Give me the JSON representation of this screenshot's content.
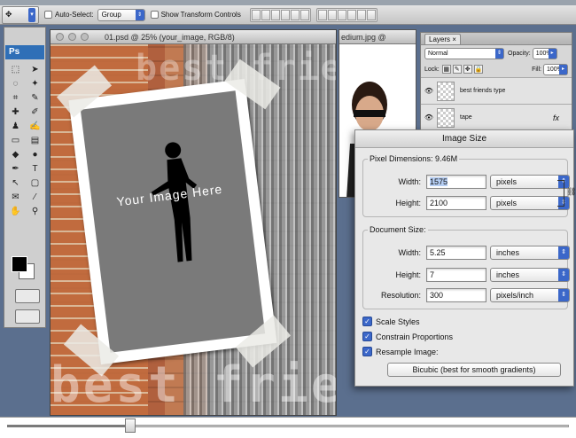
{
  "options_bar": {
    "auto_select_label": "Auto-Select:",
    "auto_select_value": "Group",
    "show_transform_label": "Show Transform Controls"
  },
  "tools_panel": {
    "brand": "Ps"
  },
  "document": {
    "title": "01.psd @ 25% (your_image, RGB/8)",
    "headline_top": "best friends",
    "headline_bottom": "best friends",
    "placeholder_text": "Your Image Here"
  },
  "document2": {
    "title": "edium.jpg @"
  },
  "layers_panel": {
    "tab": "Layers",
    "blend_mode": "Normal",
    "opacity_label": "Opacity:",
    "opacity_value": "100%",
    "lock_label": "Lock:",
    "fill_label": "Fill:",
    "fill_value": "100%",
    "layers": [
      {
        "name": "best friends type"
      },
      {
        "name": "tape",
        "fx": "fx"
      }
    ]
  },
  "image_size_dialog": {
    "title": "Image Size",
    "pixel_dimensions_label": "Pixel Dimensions:",
    "pixel_dimensions_value": "9.46M",
    "width_label": "Width:",
    "width_value": "1575",
    "width_unit": "pixels",
    "height_label": "Height:",
    "height_value": "2100",
    "height_unit": "pixels",
    "document_size_label": "Document Size:",
    "doc_width_label": "Width:",
    "doc_width_value": "5.25",
    "doc_width_unit": "inches",
    "doc_height_label": "Height:",
    "doc_height_value": "7",
    "doc_height_unit": "inches",
    "resolution_label": "Resolution:",
    "resolution_value": "300",
    "resolution_unit": "pixels/inch",
    "scale_styles": "Scale Styles",
    "constrain": "Constrain Proportions",
    "resample": "Resample Image:",
    "resample_method": "Bicubic (best for smooth gradients)"
  },
  "playback": {
    "progress_fraction": 0.22
  }
}
